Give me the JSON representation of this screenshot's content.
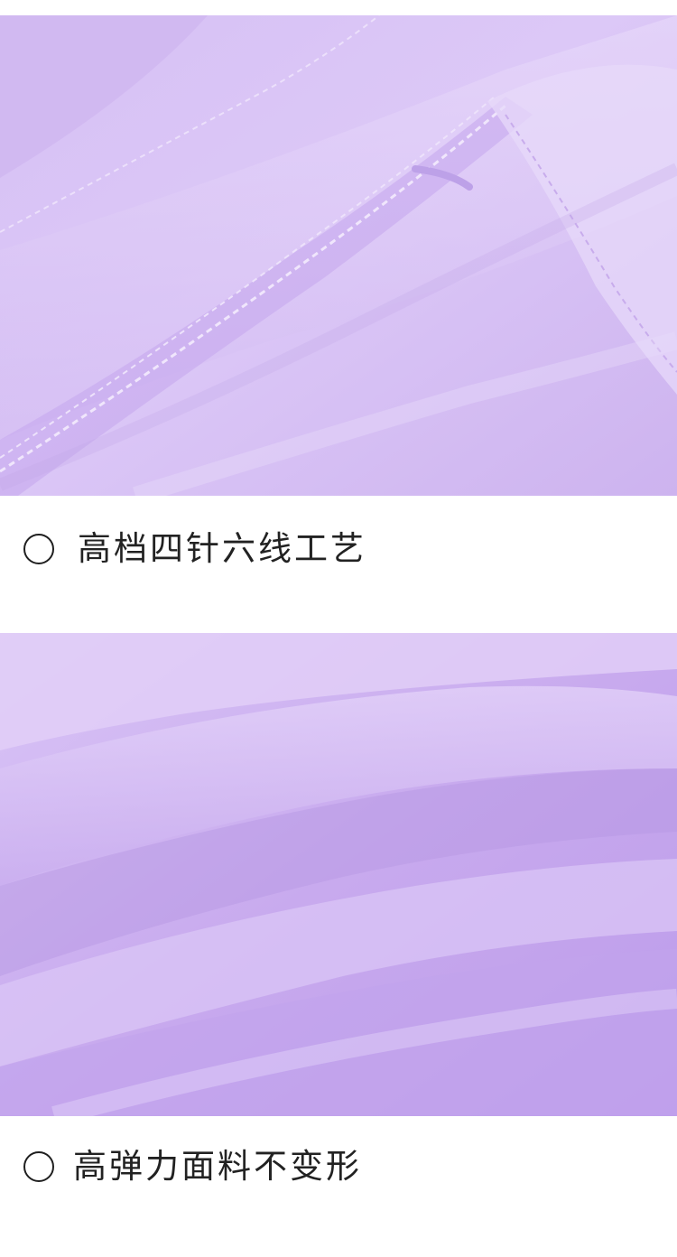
{
  "features": [
    {
      "caption": "高档四针六线工艺",
      "image": "close-up of lavender fabric showing four-needle six-thread stitched seam",
      "bullet_icon": "circle-outline-icon"
    },
    {
      "caption": "高弹力面料不变形",
      "image": "close-up of draped lavender stretch fabric folds",
      "bullet_icon": "circle-outline-icon"
    }
  ],
  "colors": {
    "fabric_light": "#e2d0f8",
    "fabric_mid": "#c9aef0",
    "fabric_shadow": "#b393e2",
    "text": "#222222",
    "background": "#ffffff"
  }
}
